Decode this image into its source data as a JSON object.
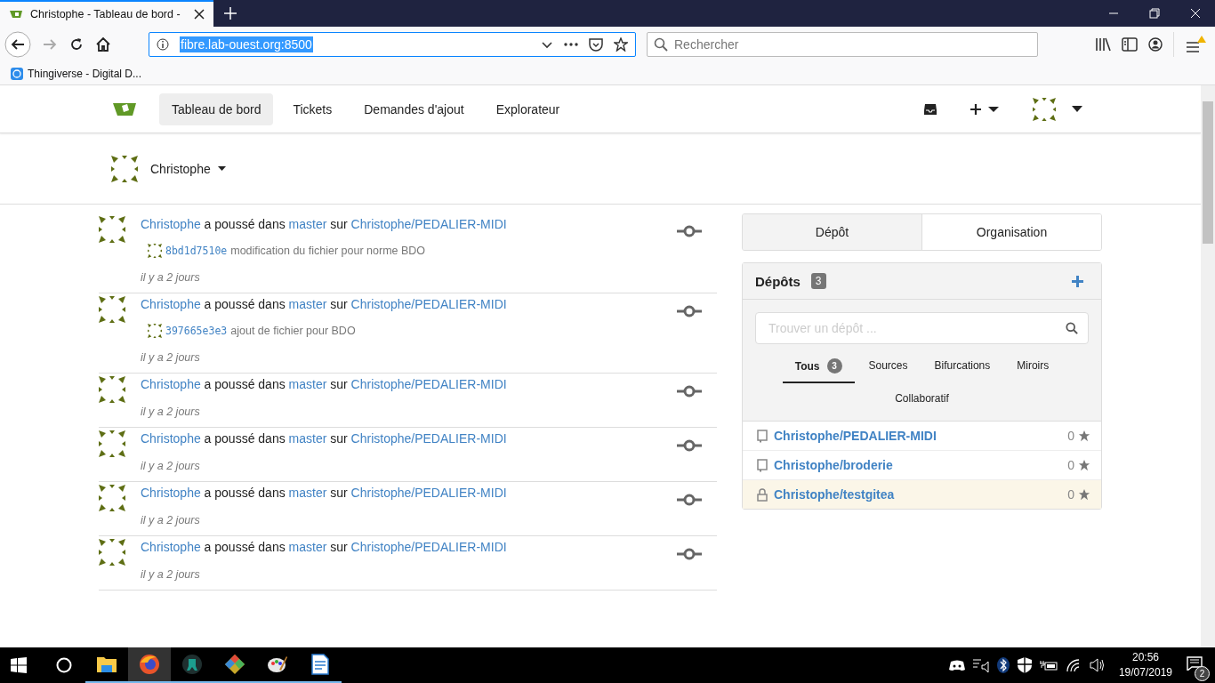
{
  "browser": {
    "tabs": [
      {
        "title": "Christophe - Tableau de bord -",
        "selected": true
      }
    ],
    "url": "fibre.lab-ouest.org:8500",
    "search": {
      "placeholder": "Rechercher"
    },
    "bookmarks": [
      {
        "label": "Thingiverse - Digital D..."
      }
    ]
  },
  "nav": {
    "items": [
      {
        "label": "Tableau de bord",
        "selected": true
      },
      {
        "label": "Tickets",
        "selected": false
      },
      {
        "label": "Demandes d'ajout",
        "selected": false
      },
      {
        "label": "Explorateur",
        "selected": false
      }
    ]
  },
  "header": {
    "user": "Christophe"
  },
  "feed": [
    {
      "user": "Christophe",
      "action": "a poussé dans",
      "branch": "master",
      "prep": "sur",
      "repo": "Christophe/PEDALIER-MIDI",
      "commits": [
        {
          "sha": "8bd1d7510e",
          "message": "modification du fichier pour norme BDO"
        }
      ],
      "time": "il y a 2 jours"
    },
    {
      "user": "Christophe",
      "action": "a poussé dans",
      "branch": "master",
      "prep": "sur",
      "repo": "Christophe/PEDALIER-MIDI",
      "commits": [
        {
          "sha": "397665e3e3",
          "message": "ajout de fichier pour BDO"
        }
      ],
      "time": "il y a 2 jours"
    },
    {
      "user": "Christophe",
      "action": "a poussé dans",
      "branch": "master",
      "prep": "sur",
      "repo": "Christophe/PEDALIER-MIDI",
      "time": "il y a 2 jours"
    },
    {
      "user": "Christophe",
      "action": "a poussé dans",
      "branch": "master",
      "prep": "sur",
      "repo": "Christophe/PEDALIER-MIDI",
      "time": "il y a 2 jours"
    },
    {
      "user": "Christophe",
      "action": "a poussé dans",
      "branch": "master",
      "prep": "sur",
      "repo": "Christophe/PEDALIER-MIDI",
      "time": "il y a 2 jours"
    },
    {
      "user": "Christophe",
      "action": "a poussé dans",
      "branch": "master",
      "prep": "sur",
      "repo": "Christophe/PEDALIER-MIDI",
      "time": "il y a 2 jours"
    }
  ],
  "sidebar": {
    "tabs": [
      {
        "label": "Dépôt",
        "selected": true
      },
      {
        "label": "Organisation",
        "selected": false
      }
    ],
    "repos": {
      "title": "Dépôts",
      "count": "3",
      "search": {
        "placeholder": "Trouver un dépôt ..."
      },
      "filters": [
        {
          "label": "Tous",
          "count": "3",
          "selected": true
        },
        {
          "label": "Sources",
          "selected": false
        },
        {
          "label": "Bifurcations",
          "selected": false
        },
        {
          "label": "Miroirs",
          "selected": false
        },
        {
          "label": "Collaboratif",
          "selected": false
        }
      ],
      "items": [
        {
          "name": "Christophe/PEDALIER-MIDI",
          "kind": "public",
          "stars": "0"
        },
        {
          "name": "Christophe/broderie",
          "kind": "public",
          "stars": "0"
        },
        {
          "name": "Christophe/testgitea",
          "kind": "private",
          "stars": "0"
        }
      ]
    }
  },
  "taskbar": {
    "apps": [
      {
        "kind": "explorer",
        "selected": false
      },
      {
        "kind": "firefox",
        "selected": true
      },
      {
        "kind": "gitkraken",
        "selected": false
      },
      {
        "kind": "git",
        "selected": false
      },
      {
        "kind": "paint",
        "selected": false
      },
      {
        "kind": "writer",
        "selected": false
      }
    ],
    "time": "20:56",
    "date": "19/07/2019",
    "notifications": "2"
  }
}
